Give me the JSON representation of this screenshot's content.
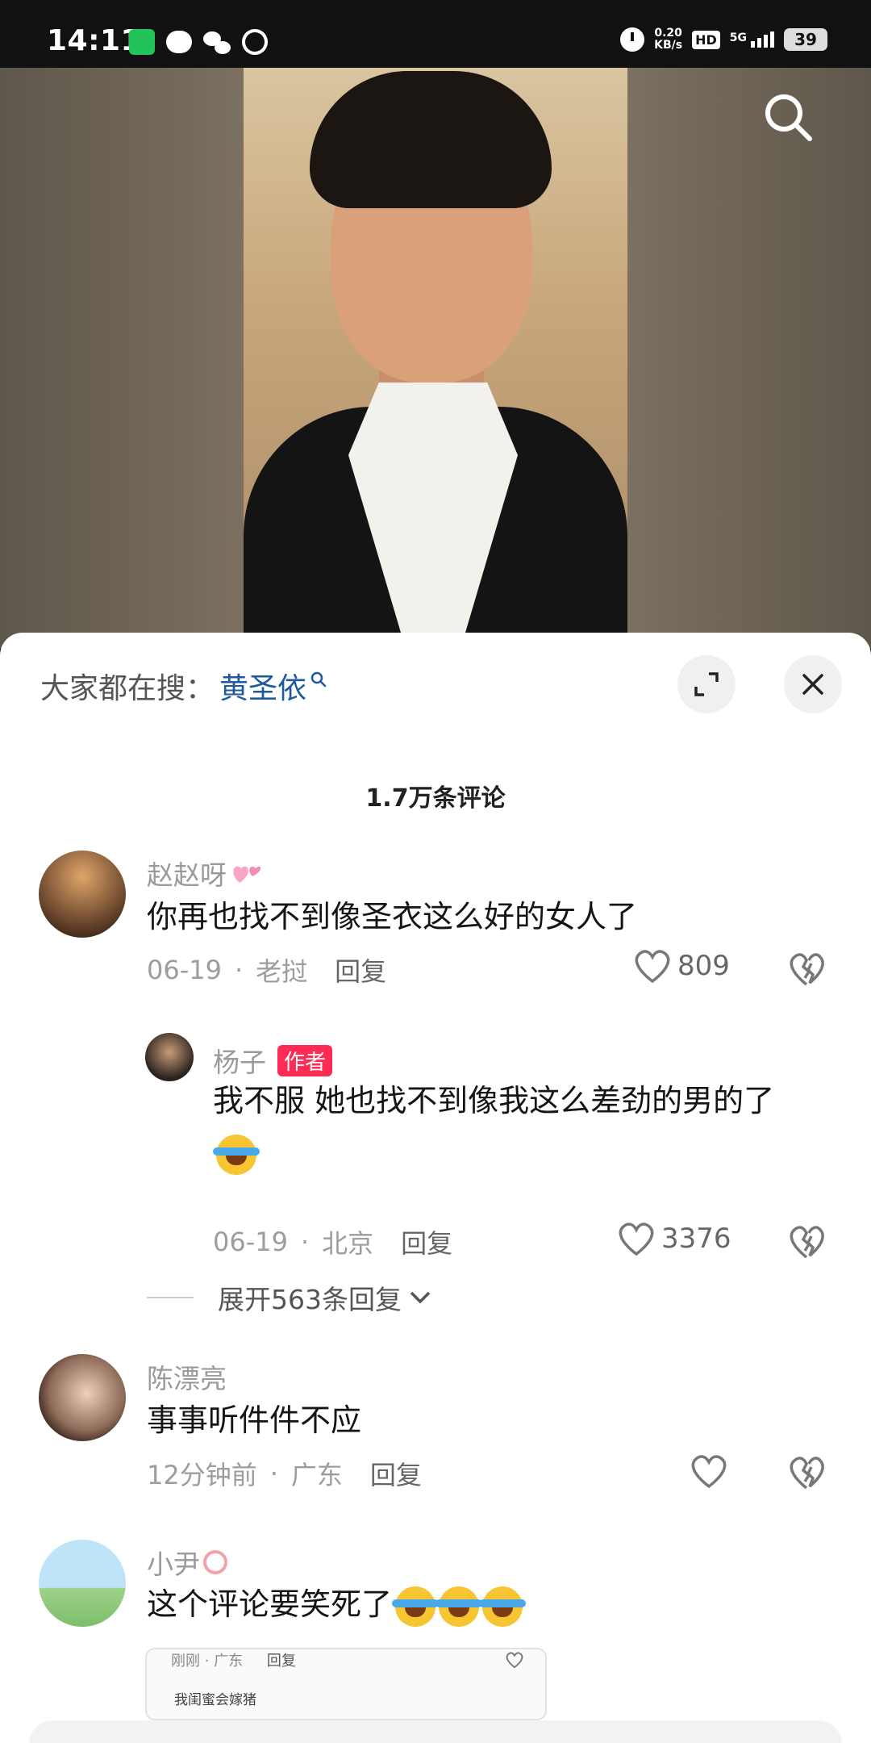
{
  "status_bar": {
    "time": "14:11",
    "speed_value": "0.20",
    "speed_unit": "KB/s",
    "hd": "HD",
    "network": "5G",
    "battery": "39"
  },
  "search_banner": {
    "prefix": "大家都在搜：",
    "keyword": "黄圣依"
  },
  "comment_count": "1.7万条评论",
  "comments": [
    {
      "username": "赵赵呀",
      "text": "你再也找不到像圣衣这么好的女人了",
      "date": "06-19",
      "location": "老挝",
      "reply_label": "回复",
      "likes": "809"
    },
    {
      "username": "陈漂亮",
      "text": "事事听件件不应",
      "date": "12分钟前",
      "location": "广东",
      "reply_label": "回复",
      "likes": ""
    },
    {
      "username": "小尹",
      "text": "这个评论要笑死了",
      "embed": {
        "time": "刚刚",
        "location": "广东",
        "reply_label": "回复",
        "text": "我闺蜜会嫁猪"
      }
    }
  ],
  "reply": {
    "username": "杨子",
    "badge": "作者",
    "text": "我不服 她也找不到像我这么差劲的男的了",
    "date": "06-19",
    "location": "北京",
    "reply_label": "回复",
    "likes": "3376"
  },
  "expand_replies": "展开563条回复",
  "colors": {
    "badge": "#fe2c55",
    "keyword": "#1f5a9c",
    "iqiyi": "#20c45a"
  },
  "icons": [
    "search-icon",
    "expand-icon",
    "close-icon",
    "heart-icon",
    "broken-heart-icon",
    "chevron-down-icon",
    "alarm-icon"
  ]
}
